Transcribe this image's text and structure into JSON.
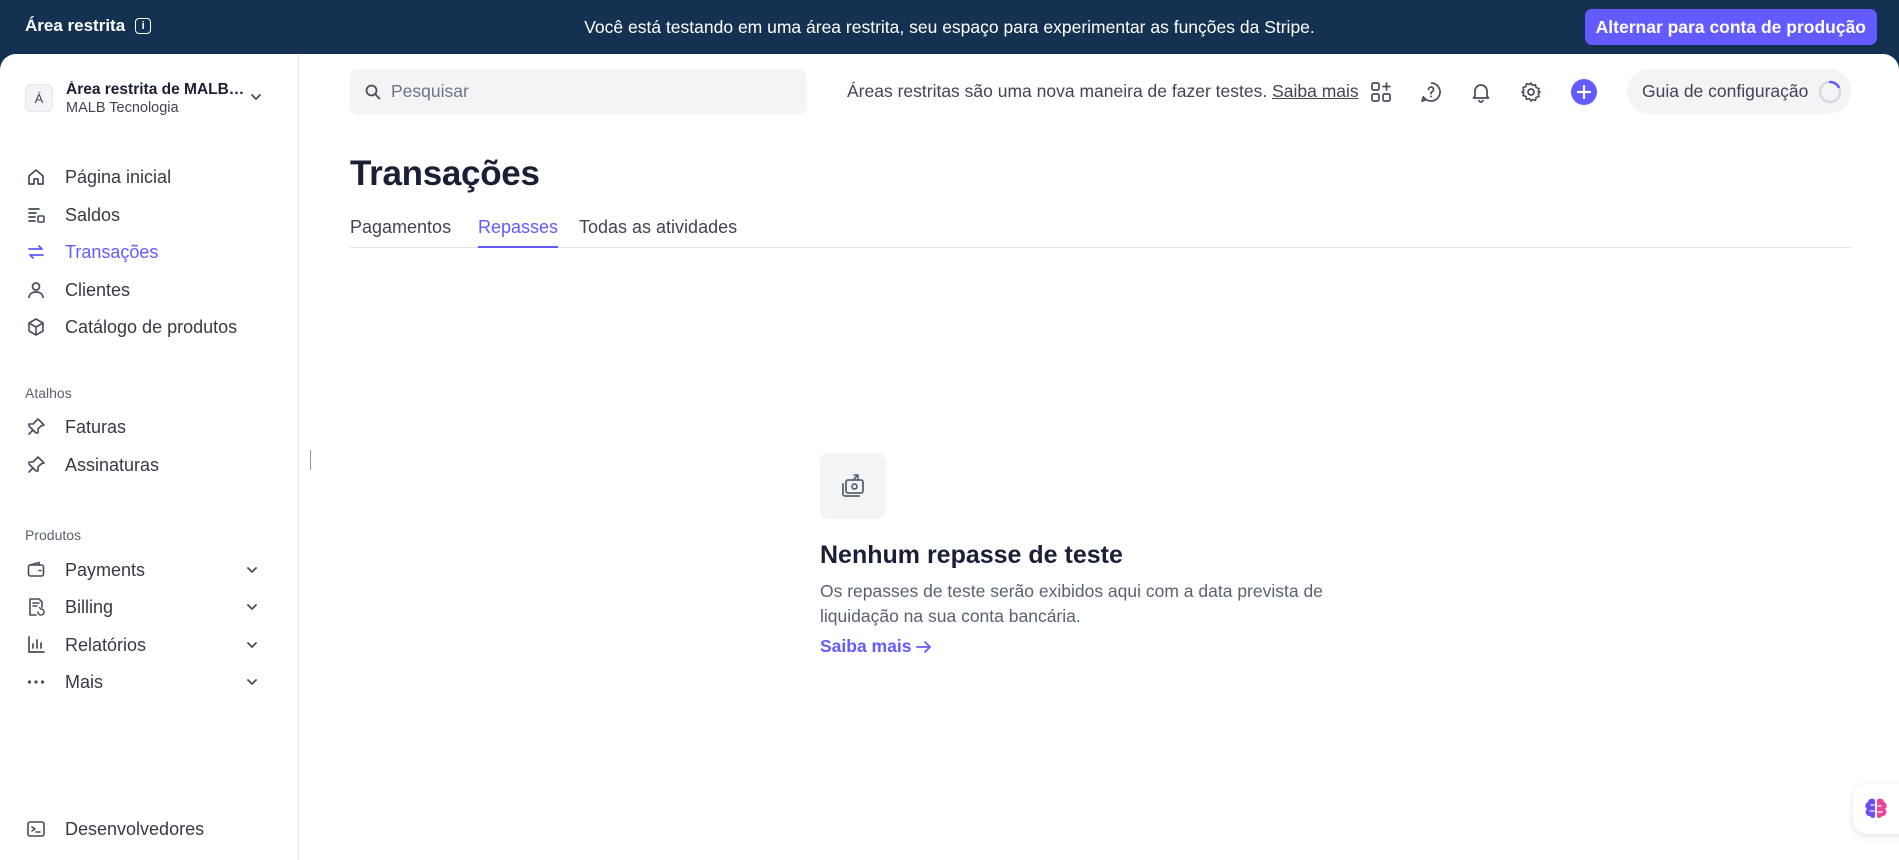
{
  "banner": {
    "title": "Área restrita",
    "message": "Você está testando em uma área restrita, seu espaço para experimentar as funções da Stripe.",
    "switch_button": "Alternar para conta de produção"
  },
  "account": {
    "initial": "Á",
    "name": "Área restrita de MALB Tecnologia",
    "company": "MALB Tecnologia"
  },
  "sidebar": {
    "main_items": [
      {
        "label": "Página inicial",
        "icon": "home-icon"
      },
      {
        "label": "Saldos",
        "icon": "balances-icon"
      },
      {
        "label": "Transações",
        "icon": "transactions-icon",
        "active": true
      },
      {
        "label": "Clientes",
        "icon": "customers-icon"
      },
      {
        "label": "Catálogo de produtos",
        "icon": "product-catalog-icon"
      }
    ],
    "shortcuts_label": "Atalhos",
    "shortcuts": [
      {
        "label": "Faturas",
        "icon": "pin-icon"
      },
      {
        "label": "Assinaturas",
        "icon": "pin-icon"
      }
    ],
    "products_label": "Produtos",
    "products": [
      {
        "label": "Payments",
        "icon": "wallet-icon"
      },
      {
        "label": "Billing",
        "icon": "billing-icon"
      },
      {
        "label": "Relatórios",
        "icon": "reports-icon"
      },
      {
        "label": "Mais",
        "icon": "more-dots-icon"
      }
    ],
    "developers": {
      "label": "Desenvolvedores",
      "icon": "terminal-icon"
    }
  },
  "topbar": {
    "search_placeholder": "Pesquisar",
    "sandbox_note": "Áreas restritas são uma nova maneira de fazer testes.",
    "sandbox_link": "Saiba mais",
    "setup_guide": "Guia de configuração",
    "accent": "#635bff"
  },
  "page": {
    "title": "Transações",
    "tabs": [
      {
        "label": "Pagamentos"
      },
      {
        "label": "Repasses",
        "active": true
      },
      {
        "label": "Todas as atividades"
      }
    ]
  },
  "empty_state": {
    "title": "Nenhum repasse de teste",
    "description": "Os repasses de teste serão exibidos aqui com a data prevista de liquidação na sua conta bancária.",
    "link": "Saiba mais"
  }
}
